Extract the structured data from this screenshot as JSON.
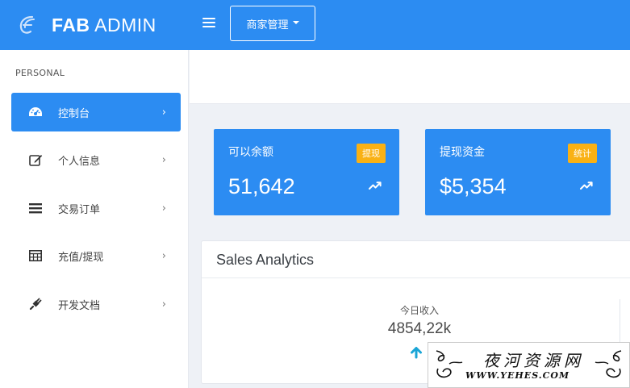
{
  "brand": {
    "bold": "FAB",
    "light": "ADMIN"
  },
  "topbar": {
    "dropdown_label": "商家管理"
  },
  "sidebar": {
    "section": "PERSONAL",
    "items": [
      {
        "label": "控制台",
        "icon": "dashboard-icon",
        "active": true
      },
      {
        "label": "个人信息",
        "icon": "edit-icon"
      },
      {
        "label": "交易订单",
        "icon": "list-icon"
      },
      {
        "label": "充值/提现",
        "icon": "table-icon"
      },
      {
        "label": "开发文档",
        "icon": "plug-icon"
      }
    ],
    "chevron": "›"
  },
  "cards": [
    {
      "title": "可以余额",
      "badge": "提现",
      "value": "51,642"
    },
    {
      "title": "提现资金",
      "badge": "统计",
      "value": "$5,354"
    }
  ],
  "analytics": {
    "title": "Sales Analytics",
    "stat_label": "今日收入",
    "stat_value": "4854,22k"
  },
  "watermark": {
    "main": "夜河资源网",
    "sub": "WWW.YEHES.COM"
  },
  "colors": {
    "primary": "#2c8cf2",
    "badge": "#f9b115",
    "arrow": "#1aa5d6"
  }
}
